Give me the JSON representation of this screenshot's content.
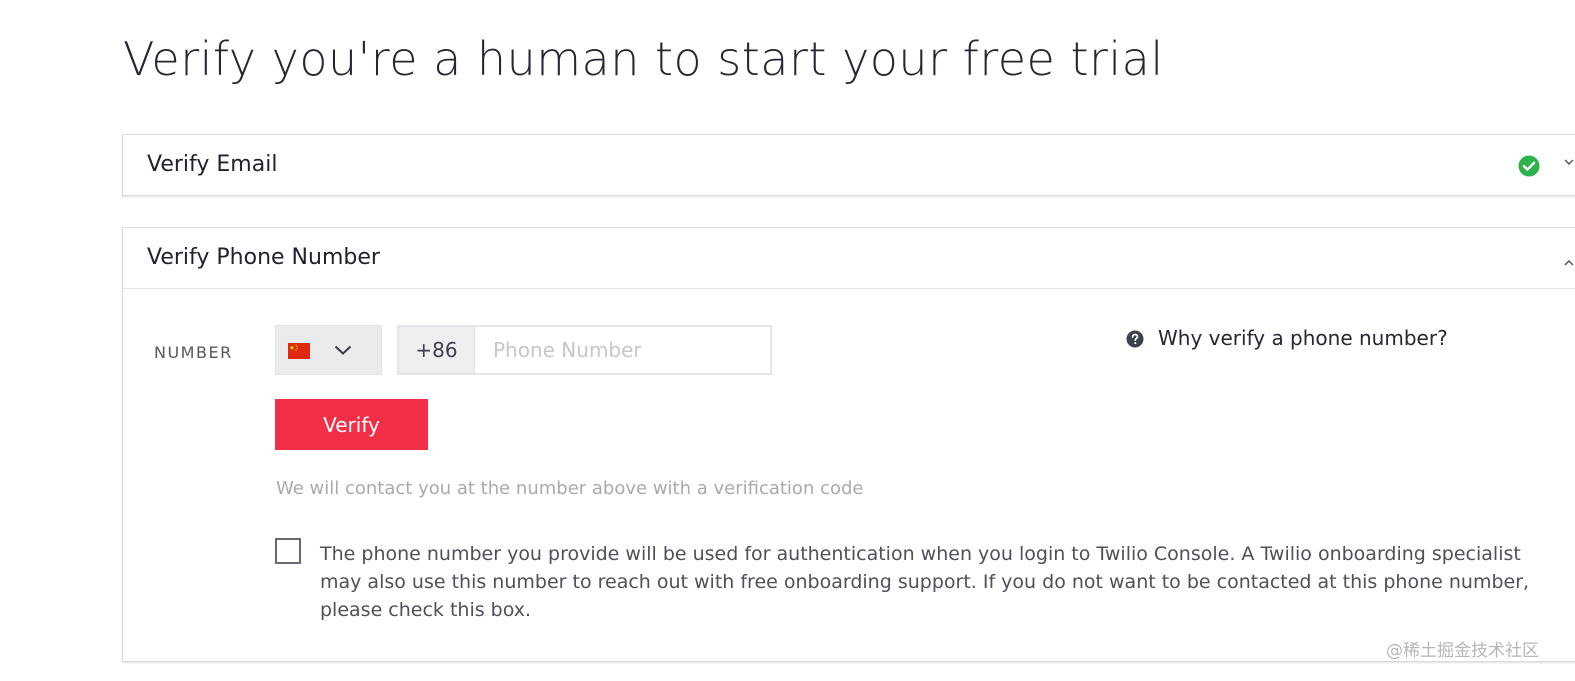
{
  "page": {
    "title": "Verify you're a human to start your free trial"
  },
  "email_section": {
    "title": "Verify Email",
    "status_icon": "check-circle-icon",
    "status_color": "#2db34a"
  },
  "phone_section": {
    "title": "Verify Phone Number",
    "number_label": "NUMBER",
    "country_flag": "china-flag-icon",
    "dial_code": "+86",
    "phone_placeholder": "Phone Number",
    "phone_value": "",
    "help_link": "Why verify a phone number?",
    "verify_button": "Verify",
    "hint": "We will contact you at the number above with a verification code",
    "consent_text": "The phone number you provide will be used for authentication when you login to Twilio Console. A Twilio onboarding specialist may also use this number to reach out with free onboarding support. If you do not want to be contacted at this phone number, please check this box.",
    "consent_checked": false
  },
  "watermark": "@稀土掘金技术社区",
  "colors": {
    "accent": "#f22f46",
    "success": "#2db34a",
    "flag_red": "#de2910",
    "flag_yellow": "#ffde00"
  }
}
